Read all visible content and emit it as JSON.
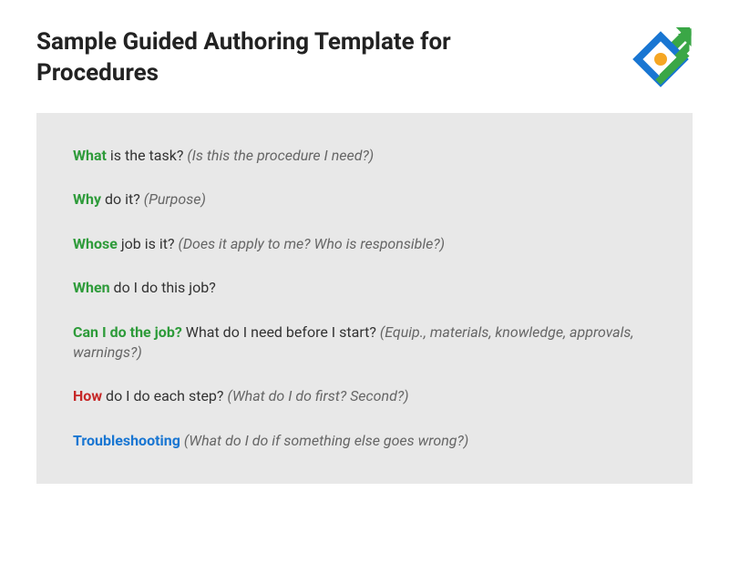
{
  "title": "Sample Guided Authoring Template for Procedures",
  "items": [
    {
      "kw": "What",
      "kw_color": "green",
      "q": " is the task? ",
      "hint": "(Is this the procedure I need?)"
    },
    {
      "kw": "Why",
      "kw_color": "green",
      "q": " do it? ",
      "hint": "(Purpose)"
    },
    {
      "kw": "Whose",
      "kw_color": "green",
      "q": " job is it? ",
      "hint": "(Does it apply to me? Who is responsible?)"
    },
    {
      "kw": "When",
      "kw_color": "green",
      "q": " do I do this job?",
      "hint": ""
    },
    {
      "kw": "Can I do the job?",
      "kw_color": "green",
      "q": " What do I need before I start? ",
      "hint": "(Equip., materials, knowledge, approvals, warnings?)"
    },
    {
      "kw": "How",
      "kw_color": "red",
      "q": " do I do each step? ",
      "hint": "(What do I do first? Second?)"
    },
    {
      "kw": "Troubleshooting",
      "kw_color": "blue",
      "q": " ",
      "hint": "(What do I do if something else goes wrong?)"
    }
  ]
}
